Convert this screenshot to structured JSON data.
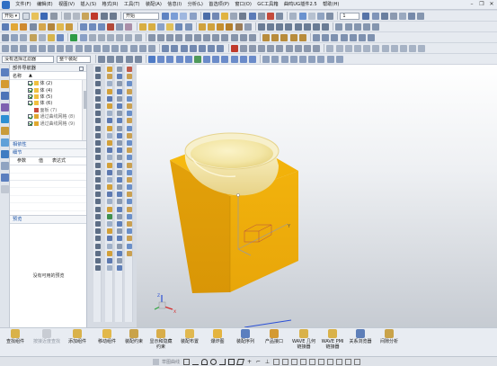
{
  "menu": {
    "items": [
      "文件(F)",
      "编辑(E)",
      "视图(V)",
      "插入(S)",
      "格式(R)",
      "工具(T)",
      "装配(A)",
      "信息(I)",
      "分析(L)",
      "首选项(P)",
      "窗口(O)",
      "GC工具箱",
      "曲鸣UG插件2.5",
      "帮助(H)"
    ],
    "start_label": "开始"
  },
  "toolbar": {
    "start_combo": "开始 ▾",
    "filter_combo": "没有选择过滤器",
    "scope_combo": "整个装配",
    "snap_value": "1"
  },
  "navigator": {
    "title": "部件导航器",
    "col_name": "名称",
    "tree": [
      {
        "label": "体 (2)",
        "checked": true,
        "color": "#6a6a6a"
      },
      {
        "label": "体 (4)",
        "checked": true,
        "color": "#6a6a6a"
      },
      {
        "label": "体 (5)",
        "checked": true,
        "color": "#6a6a6a"
      },
      {
        "label": "体 (6)",
        "checked": true,
        "color": "#6a6a6a"
      },
      {
        "label": "面板 (7)",
        "checked": false,
        "color": "#6a6a6a"
      },
      {
        "label": "通过曲线网格 (8)",
        "checked": true,
        "color": "#6a6a6a"
      },
      {
        "label": "通过曲线网格 (9)",
        "checked": true,
        "color": "#6a6a6a"
      }
    ],
    "dependencies": "相依性",
    "details": "细节",
    "params_cols": [
      "参数",
      "值",
      "表达式"
    ],
    "preview": "预览",
    "preview_empty": "没有可用的预览"
  },
  "viewport": {
    "axis_x": "X",
    "axis_y": "Y",
    "axis_z": "Z",
    "box_color": "#f2b20c",
    "dish_color": "#f5ecb4"
  },
  "ribbon": {
    "items": [
      {
        "label": "查找组件",
        "dim": false
      },
      {
        "label": "按接近度查找",
        "dim": true
      },
      {
        "label": "添加组件",
        "dim": false
      },
      {
        "label": "移动组件",
        "dim": false
      },
      {
        "label": "装配约束",
        "dim": false
      },
      {
        "label": "显示和隐藏",
        "dim": false
      },
      {
        "label": "约束",
        "dim": false
      },
      {
        "label": "装配布置",
        "dim": false
      },
      {
        "label": "爆炸图",
        "dim": false
      },
      {
        "label": "装配序列",
        "dim": false
      },
      {
        "label": "产品接口",
        "dim": false
      },
      {
        "label": "WAVE 几何",
        "dim": false
      },
      {
        "label": "链接器",
        "dim": false
      },
      {
        "label": "WAVE PMI",
        "dim": false
      },
      {
        "label": "链接器",
        "dim": false
      },
      {
        "label": "关系浏览器",
        "dim": false
      },
      {
        "label": "间隙分析",
        "dim": false
      }
    ]
  },
  "status": {
    "sketch_label": "草图曲线"
  }
}
